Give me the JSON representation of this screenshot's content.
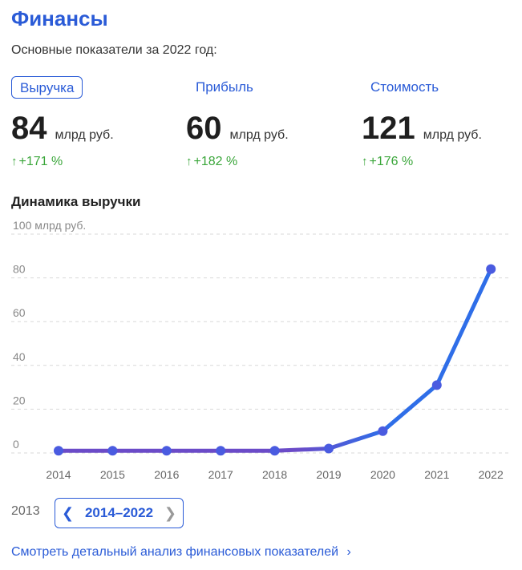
{
  "header": {
    "title": "Финансы",
    "subtitle": "Основные показатели за 2022 год:"
  },
  "tabs": [
    {
      "label": "Выручка",
      "active": true
    },
    {
      "label": "Прибыль",
      "active": false
    },
    {
      "label": "Стоимость",
      "active": false
    }
  ],
  "metrics": [
    {
      "value": "84",
      "unit": "млрд руб.",
      "growth": "+171 %"
    },
    {
      "value": "60",
      "unit": "млрд руб.",
      "growth": "+182 %"
    },
    {
      "value": "121",
      "unit": "млрд руб.",
      "growth": "+176 %"
    }
  ],
  "growth_arrow": "↑",
  "section_title": "Динамика выручки",
  "chart_data": {
    "type": "line",
    "title": "",
    "ylabel": "",
    "y_top_label": "100 млрд руб.",
    "y_ticks": [
      0,
      20,
      40,
      60,
      80
    ],
    "ylim": [
      0,
      100
    ],
    "x": [
      "2014",
      "2015",
      "2016",
      "2017",
      "2018",
      "2019",
      "2020",
      "2021",
      "2022"
    ],
    "series": [
      {
        "values": [
          1,
          1,
          1,
          1,
          1,
          2,
          10,
          31,
          84
        ]
      }
    ],
    "grid": true,
    "line_color_start": "#6b4bc8",
    "line_color_end": "#2f6ee8",
    "point_color": "#4a5be0"
  },
  "period": {
    "prev_label": "2013",
    "current_label": "2014–2022",
    "prev_icon": "chevron-left-icon",
    "next_icon": "chevron-right-icon"
  },
  "detail_link": {
    "label": "Смотреть детальный анализ финансовых показателей",
    "icon": "chevron-right-icon"
  },
  "colors": {
    "accent": "#2a5bd7",
    "growth": "#3aa63a"
  }
}
